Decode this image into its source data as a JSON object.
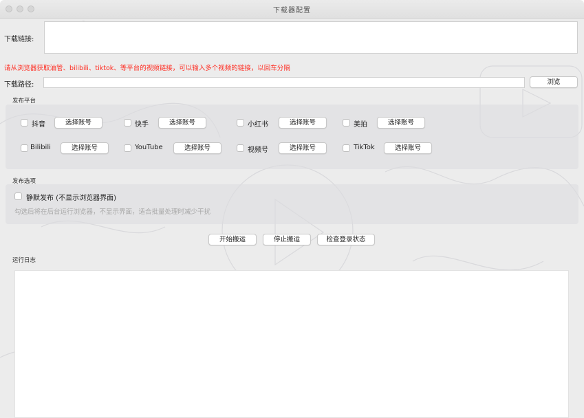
{
  "window": {
    "title": "下载器配置"
  },
  "download_url": {
    "label": "下载链接:",
    "value": ""
  },
  "hint_text": "请从浏览器获取油管、bilibili、tiktok、等平台的视频链接，可以输入多个视频的链接，以回车分隔",
  "download_path": {
    "label": "下载路径:",
    "value": "",
    "browse_label": "浏览"
  },
  "publish_platforms": {
    "title": "发布平台",
    "select_account_label": "选择账号",
    "platforms": [
      {
        "name": "抖音",
        "checked": false
      },
      {
        "name": "快手",
        "checked": false
      },
      {
        "name": "小红书",
        "checked": false
      },
      {
        "name": "美拍",
        "checked": false
      },
      {
        "name": "Bilibili",
        "checked": false
      },
      {
        "name": "YouTube",
        "checked": false
      },
      {
        "name": "视频号",
        "checked": false
      },
      {
        "name": "TikTok",
        "checked": false
      }
    ]
  },
  "publish_options": {
    "title": "发布选项",
    "silent_label": "静默发布 (不显示浏览器界面)",
    "silent_checked": false,
    "silent_desc": "勾选后将在后台运行浏览器，不显示界面，适合批量处理时减少干扰"
  },
  "actions": {
    "start": "开始搬运",
    "stop": "停止搬运",
    "check_login": "检查登录状态"
  },
  "log": {
    "title": "运行日志",
    "content": ""
  },
  "colors": {
    "hint": "#ff2a1f",
    "window_bg": "#ececec"
  }
}
